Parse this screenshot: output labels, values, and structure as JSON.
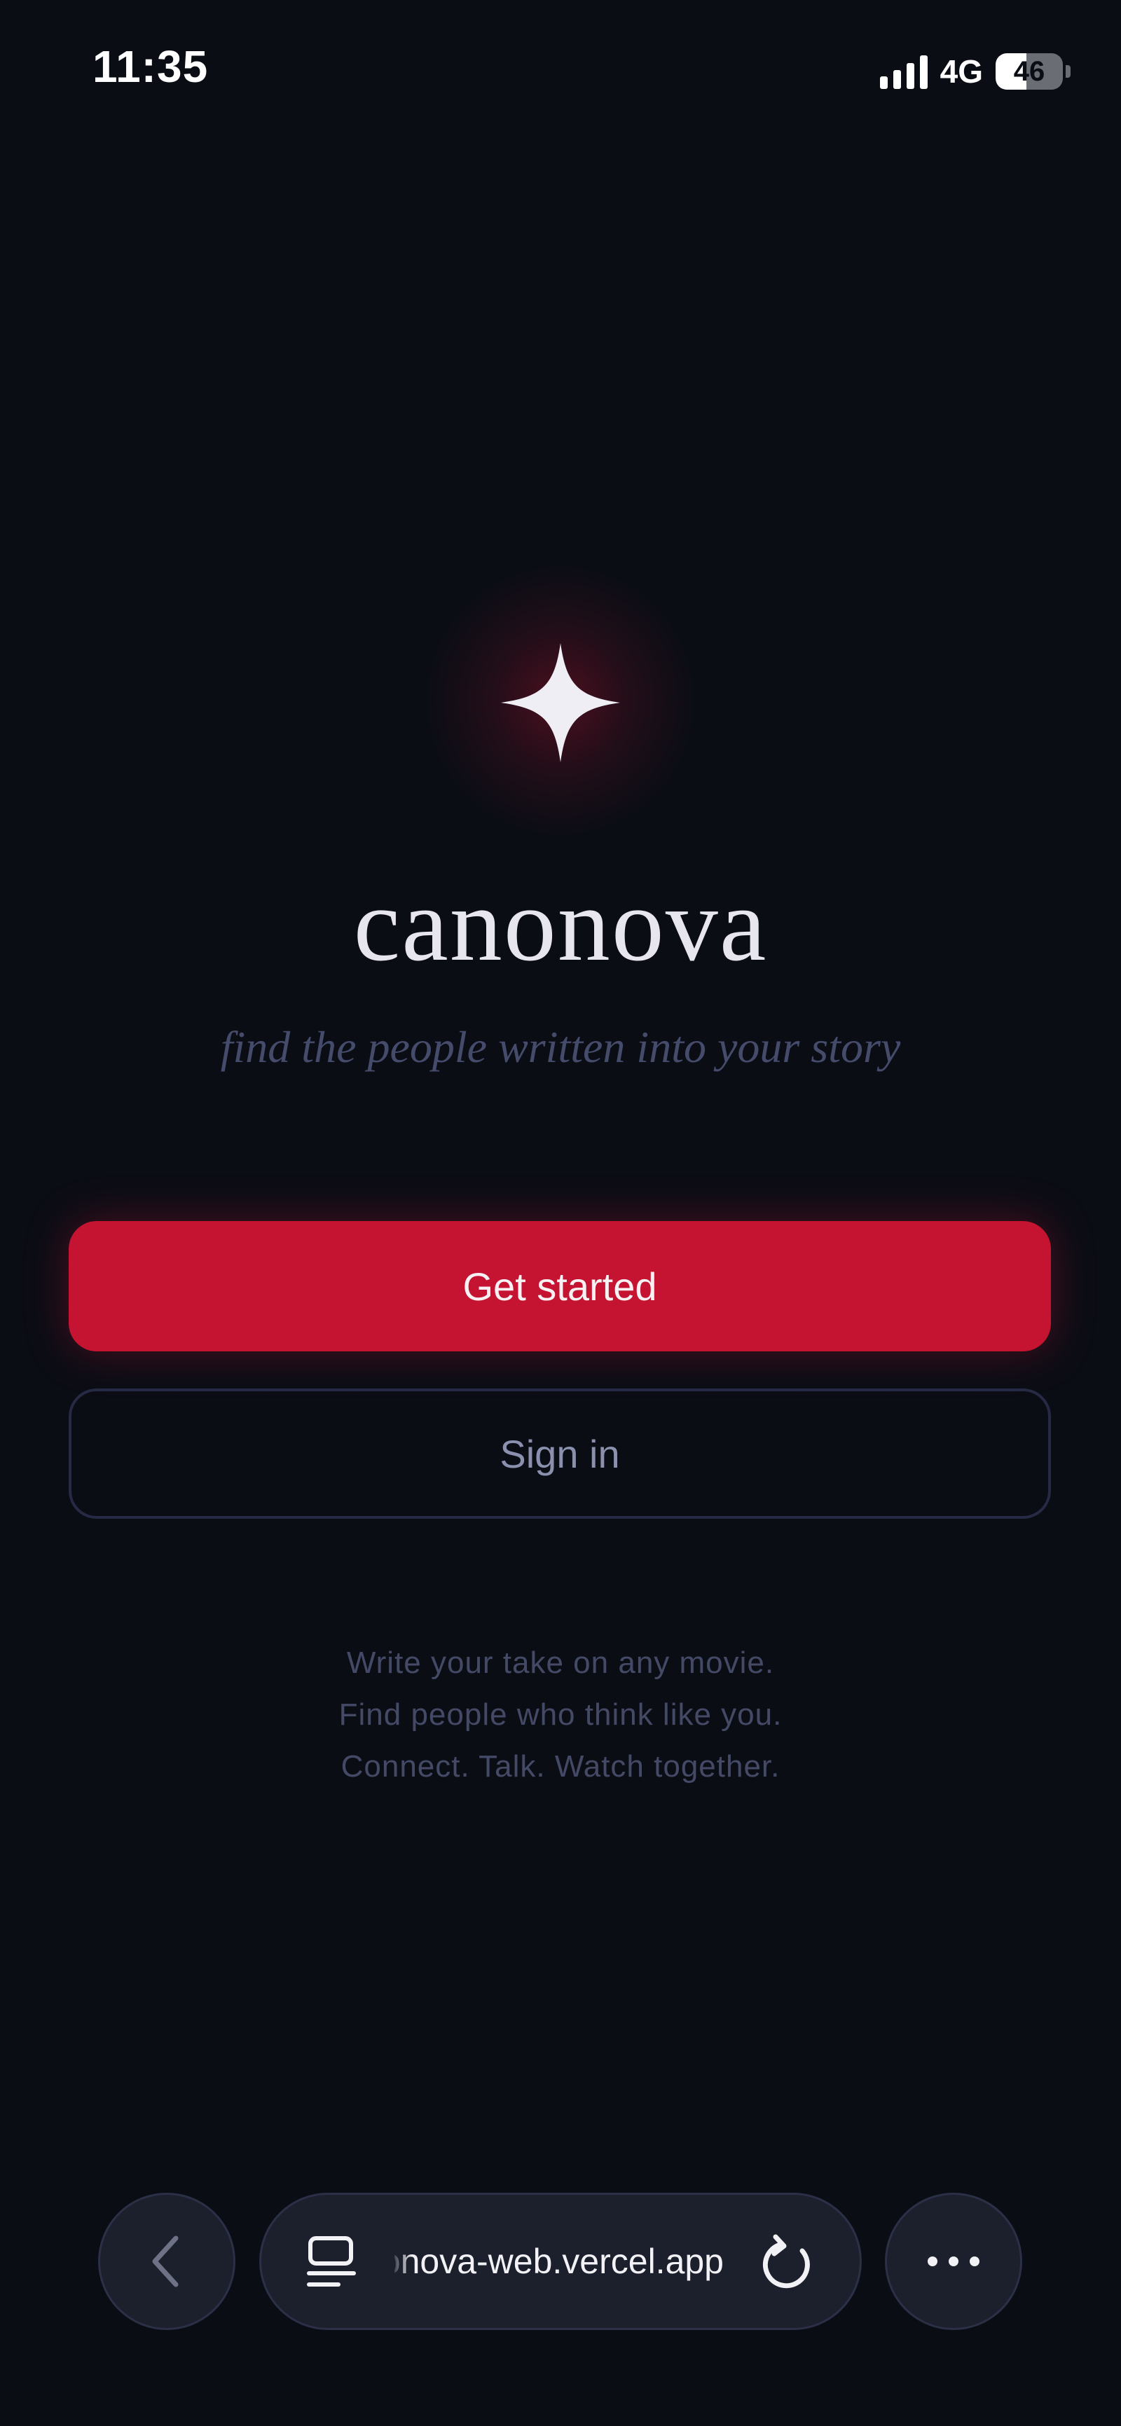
{
  "status_bar": {
    "time": "11:35",
    "network": "4G",
    "battery_level": "46",
    "battery_fraction": 0.46,
    "icons": [
      "signal-icon",
      "battery-icon"
    ]
  },
  "hero": {
    "logo_icon": "four-point-star-icon",
    "brand_name": "canonova",
    "tagline": "find the people written into your story"
  },
  "actions": {
    "primary_label": "Get started",
    "secondary_label": "Sign in"
  },
  "description": {
    "lines": [
      "Write your take on any movie.",
      "Find people who think like you.",
      "Connect. Talk. Watch together."
    ]
  },
  "browser_bar": {
    "url": "canonova-web.vercel.app",
    "icons": [
      "back-chevron-icon",
      "tabs-icon",
      "reload-icon",
      "more-icon"
    ]
  },
  "colors": {
    "background": "#0b0d15",
    "accent": "#c41432",
    "brand_text": "#e7e6ee",
    "tagline": "#454b6b",
    "secondary_text": "#8a90ad",
    "muted_text": "#444a66"
  }
}
